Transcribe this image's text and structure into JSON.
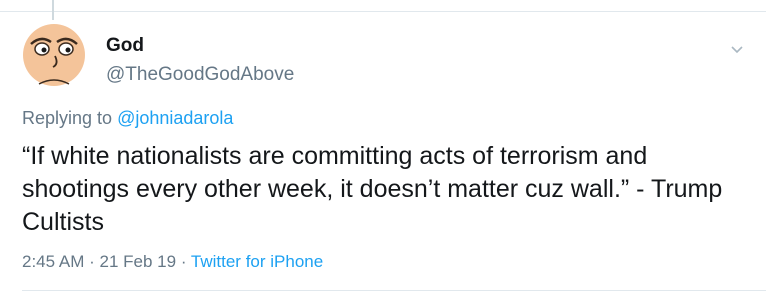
{
  "tweet": {
    "display_name": "God",
    "handle": "@TheGoodGodAbove",
    "replying_prefix": "Replying to",
    "replying_to": "@johniadarola",
    "text": "“If white nationalists are committing acts of terrorism and shootings every other week, it doesn’t matter cuz wall.” - Trump Cultists",
    "time": "2:45 AM",
    "separator": "·",
    "date": "21 Feb 19",
    "source": "Twitter for iPhone"
  },
  "icons": {
    "avatar": "cartoon-face-avatar",
    "menu": "chevron-down-icon"
  },
  "colors": {
    "accent": "#1da1f2",
    "secondary_text": "#657786",
    "primary_text": "#14171a",
    "avatar_skin": "#f4c49a"
  }
}
